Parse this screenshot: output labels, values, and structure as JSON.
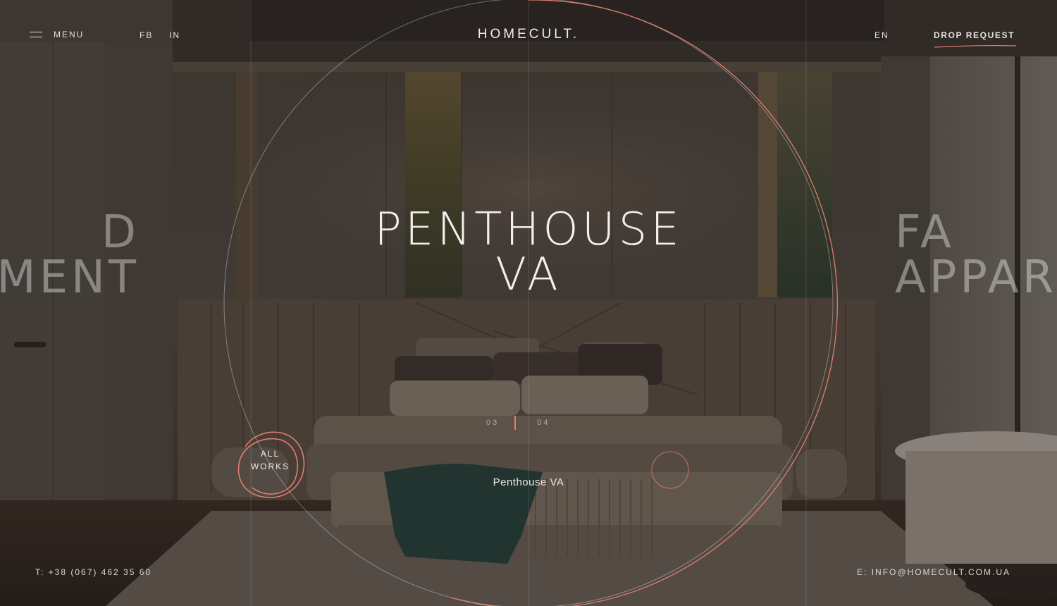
{
  "header": {
    "menu_label": "MENU",
    "social": [
      "FB",
      "IN"
    ],
    "logo": "HOMECULT.",
    "language": "EN",
    "cta_label": "DROP REQUEST"
  },
  "hero": {
    "title_line1": "PENTHOUSE",
    "title_line2": "VA",
    "prev_title_line1": "D",
    "prev_title_line2": "MENT",
    "next_title_line1": "FA",
    "next_title_line2": "APPAR",
    "counter_current": "03",
    "counter_next": "04",
    "caption": "Penthouse VA",
    "all_works_line1": "ALL",
    "all_works_line2": "WORKS"
  },
  "footer": {
    "phone": "T: +38 (067) 462 35 60",
    "email": "E: INFO@HOMECULT.COM.UA"
  },
  "colors": {
    "accent": "#e07e70",
    "text": "#e9e4df",
    "background": "#3a332e"
  },
  "icons": [
    "hamburger-icon",
    "scribble-circle-icon",
    "progress-ring-icon"
  ]
}
